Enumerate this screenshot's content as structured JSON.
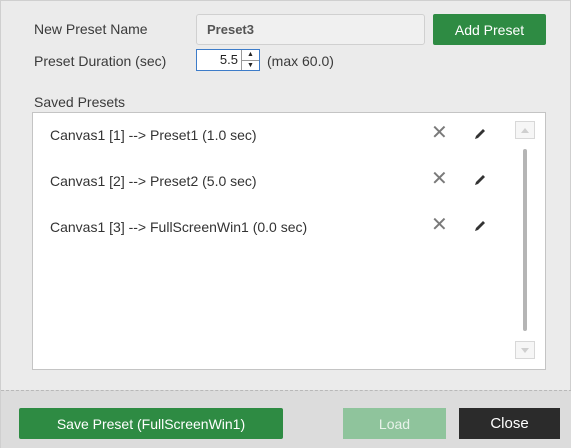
{
  "form": {
    "name_label": "New Preset Name",
    "name_value": "Preset3",
    "add_label": "Add Preset",
    "duration_label": "Preset Duration (sec)",
    "duration_value": "5.5",
    "duration_max": "(max 60.0)"
  },
  "presets": {
    "heading": "Saved Presets",
    "items": [
      {
        "label": "Canvas1 [1] --> Preset1 (1.0 sec)"
      },
      {
        "label": "Canvas1 [2] --> Preset2 (5.0 sec)"
      },
      {
        "label": "Canvas1 [3] --> FullScreenWin1 (0.0 sec)"
      }
    ]
  },
  "footer": {
    "save_label": "Save Preset (FullScreenWin1)",
    "load_label": "Load",
    "close_label": "Close"
  },
  "icons": {
    "delete": "close-icon",
    "edit": "pencil-icon",
    "spin_up": "caret-up-icon",
    "spin_down": "caret-down-icon"
  },
  "colors": {
    "primary": "#2e8b43",
    "disabled": "#8fc49c",
    "dark": "#2b2b2b",
    "focus": "#3d7cc9"
  }
}
